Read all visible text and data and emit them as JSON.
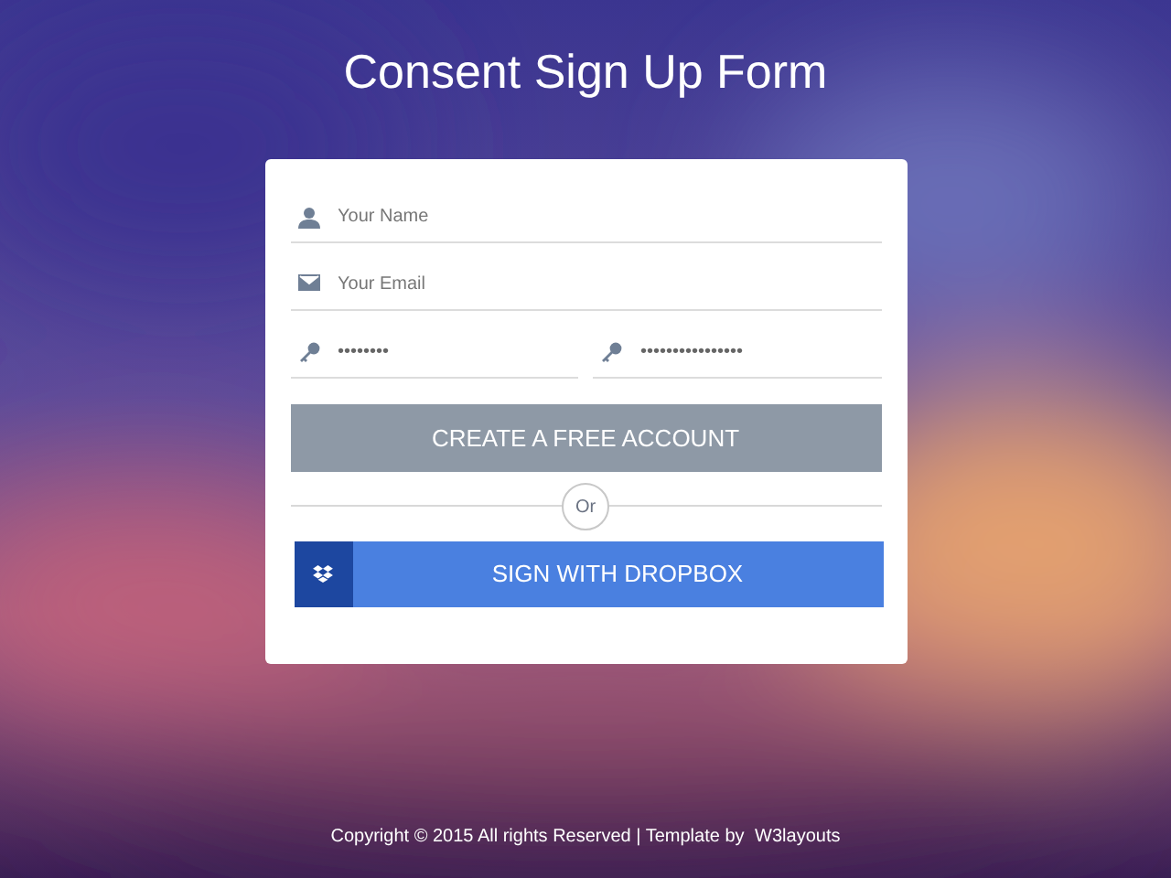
{
  "title": "Consent Sign Up Form",
  "form": {
    "fields": [
      {
        "kind": "name",
        "placeholder": "Your Name"
      },
      {
        "kind": "email",
        "placeholder": "Your Email"
      }
    ],
    "passwords": [
      {
        "value": "••••••••"
      },
      {
        "value": "••••••••••••••••"
      }
    ],
    "create_button": "CREATE A FREE ACCOUNT",
    "divider": "Or",
    "dropbox_button": "SIGN WITH DROPBOX"
  },
  "footer": {
    "text": "Copyright © 2015 All rights Reserved | Template by",
    "link": "W3layouts"
  }
}
